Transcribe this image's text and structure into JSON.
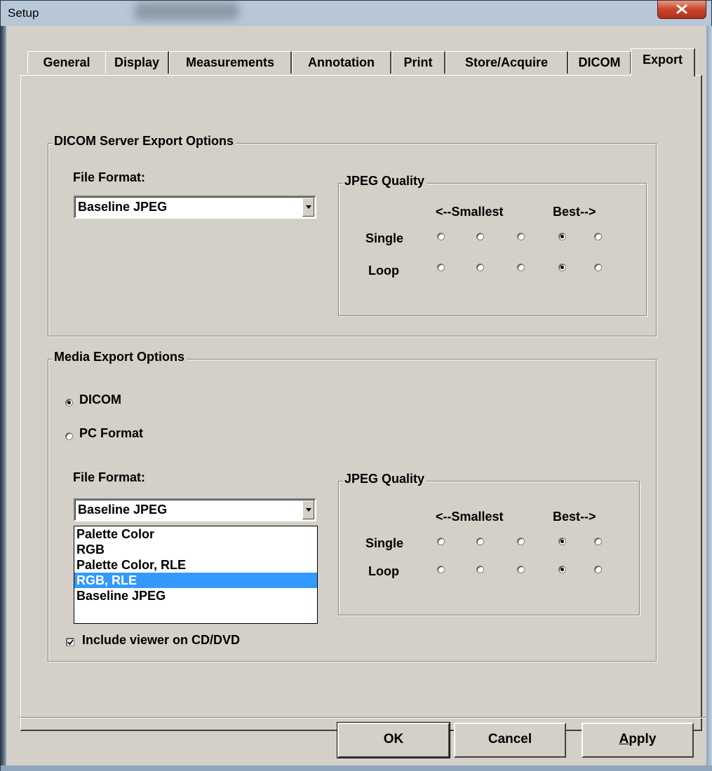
{
  "window": {
    "title": "Setup"
  },
  "tabs": [
    "General",
    "Display",
    "Measurements",
    "Annotation",
    "Print",
    "Store/Acquire",
    "DICOM",
    "Export"
  ],
  "active_tab": "Export",
  "dicom_server": {
    "group_title": "DICOM Server Export Options",
    "file_format_label": "File Format:",
    "file_format_value": "Baseline JPEG",
    "jpeg": {
      "group_title": "JPEG Quality",
      "smallest_label": "<--Smallest",
      "best_label": "Best-->",
      "single_label": "Single",
      "loop_label": "Loop",
      "single_selected": 4,
      "loop_selected": 4
    }
  },
  "media": {
    "group_title": "Media Export Options",
    "dicom_label": "DICOM",
    "pc_format_label": "PC Format",
    "selected": "DICOM",
    "file_format_label": "File Format:",
    "file_format_value": "Baseline JPEG",
    "options": [
      "Palette Color",
      "RGB",
      "Palette Color, RLE",
      "RGB, RLE",
      "Baseline JPEG"
    ],
    "highlighted_option": "RGB, RLE",
    "jpeg": {
      "group_title": "JPEG Quality",
      "smallest_label": "<--Smallest",
      "best_label": "Best-->",
      "single_label": "Single",
      "loop_label": "Loop",
      "single_selected": 4,
      "loop_selected": 4
    },
    "include_viewer_label": "Include viewer on CD/DVD",
    "include_viewer_checked": true
  },
  "buttons": {
    "ok": "OK",
    "cancel": "Cancel",
    "apply_prefix": "A",
    "apply_rest": "pply"
  }
}
